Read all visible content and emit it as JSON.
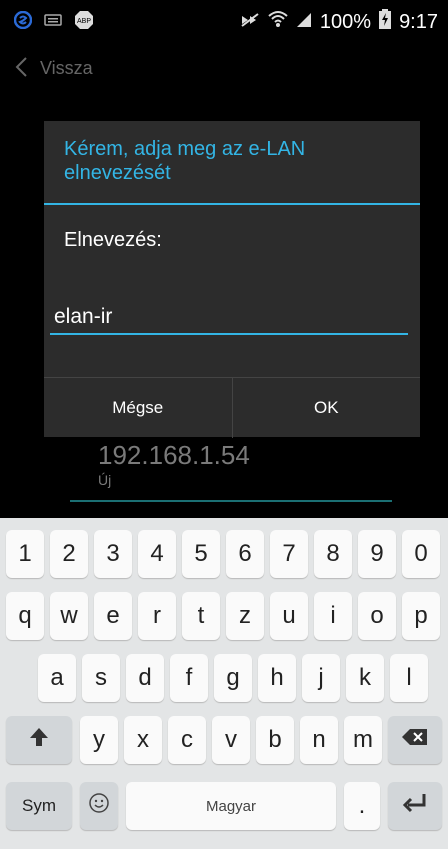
{
  "status_bar": {
    "battery": "100%",
    "time": "9:17",
    "icons": [
      "s-app-icon",
      "keyboard-icon",
      "adblock-icon",
      "mute-icon",
      "wifi-icon",
      "signal-icon",
      "battery-icon"
    ]
  },
  "app_bar": {
    "back_label": "Vissza"
  },
  "background": {
    "ip": "192.168.1.54",
    "subtitle": "Új"
  },
  "dialog": {
    "title": "Kérem, adja meg az e-LAN elnevezését",
    "field_label": "Elnevezés:",
    "input_value": "elan-ir",
    "cancel_label": "Mégse",
    "ok_label": "OK"
  },
  "keyboard": {
    "numbers": [
      "1",
      "2",
      "3",
      "4",
      "5",
      "6",
      "7",
      "8",
      "9",
      "0"
    ],
    "row1": [
      "q",
      "w",
      "e",
      "r",
      "t",
      "z",
      "u",
      "i",
      "o",
      "p"
    ],
    "row2": [
      "a",
      "s",
      "d",
      "f",
      "g",
      "h",
      "j",
      "k",
      "l"
    ],
    "row3": [
      "y",
      "x",
      "c",
      "v",
      "b",
      "n",
      "m"
    ],
    "sym_label": "Sym",
    "space_label": "Magyar",
    "period": "."
  },
  "colors": {
    "accent": "#33b5e5",
    "dialog_bg": "#2c2c2c",
    "keyboard_bg": "#e3e5e6"
  }
}
